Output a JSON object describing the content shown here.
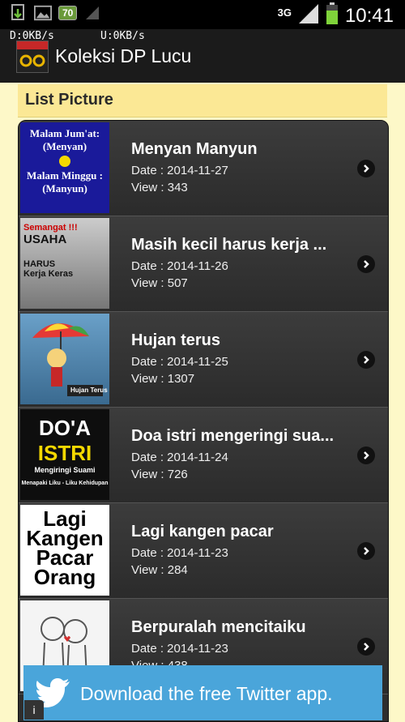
{
  "status": {
    "battery_level": "70",
    "network_type": "3G",
    "time": "10:41",
    "download_speed": "D:0KB/s",
    "upload_speed": "U:0KB/s"
  },
  "app": {
    "title": "Koleksi DP Lucu",
    "logo_text": "Koleksi DP Lucu"
  },
  "header": {
    "title": "List Picture"
  },
  "items": [
    {
      "title": "Menyan Manyun",
      "date": "Date : 2014-11-27",
      "view": "View : 343",
      "thumb_lines": [
        "Malam Jum'at:",
        "(Menyan)",
        "Malam Minggu :",
        "(Manyun)"
      ]
    },
    {
      "title": "Masih kecil harus kerja ...",
      "date": "Date : 2014-11-26",
      "view": "View : 507",
      "thumb_lines": [
        "Semangat !!!",
        "USAHA",
        "HARUS",
        "Kerja Keras"
      ]
    },
    {
      "title": "Hujan terus",
      "date": "Date : 2014-11-25",
      "view": "View : 1307",
      "thumb_lines": [
        "Hujan Terus"
      ]
    },
    {
      "title": "Doa istri mengeringi sua...",
      "date": "Date : 2014-11-24",
      "view": "View : 726",
      "thumb_lines": [
        "DO'A",
        "ISTRI",
        "Mengiringi Suami",
        "Menapaki Liku - Liku Kehidupan"
      ]
    },
    {
      "title": "Lagi kangen pacar",
      "date": "Date : 2014-11-23",
      "view": "View : 284",
      "thumb_lines": [
        "Lagi",
        "Kangen",
        "Pacar",
        "Orang"
      ]
    },
    {
      "title": "Berpuralah mencitaiku",
      "date": "Date : 2014-11-23",
      "view": "View : 438",
      "thumb_lines": []
    }
  ],
  "ad": {
    "text": "Download the free Twitter app.",
    "info_label": "i"
  }
}
